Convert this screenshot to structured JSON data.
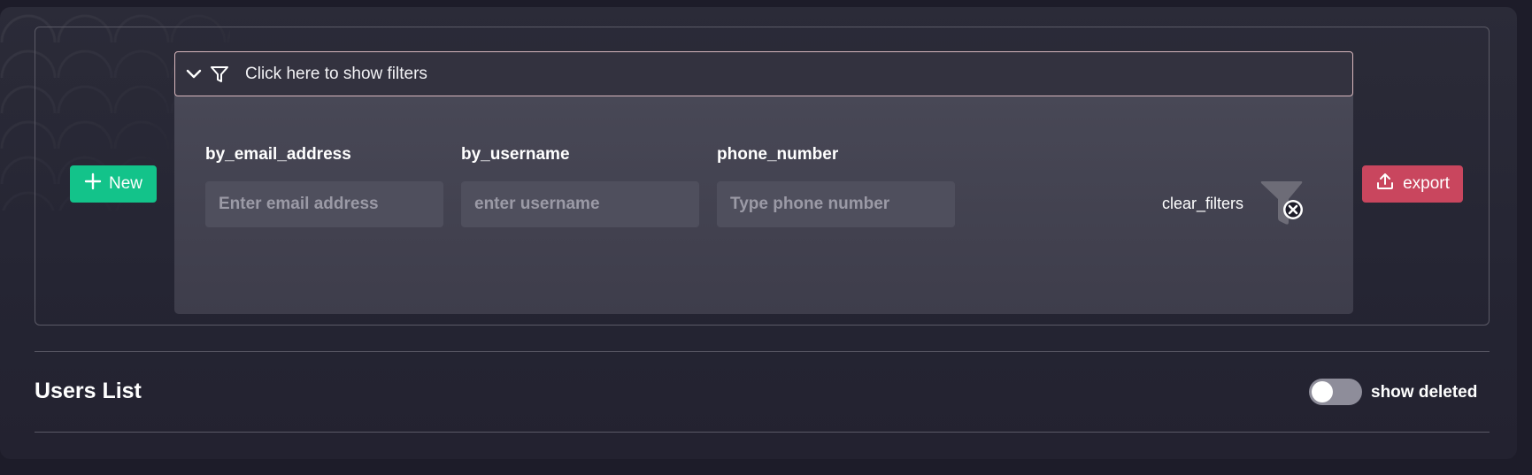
{
  "toolbar": {
    "new_label": "New",
    "export_label": "export"
  },
  "filters": {
    "header_label": "Click here to show filters",
    "email": {
      "label": "by_email_address",
      "placeholder": "Enter email address",
      "value": ""
    },
    "username": {
      "label": "by_username",
      "placeholder": "enter username",
      "value": ""
    },
    "phone": {
      "label": "phone_number",
      "placeholder": "Type phone number",
      "value": ""
    },
    "clear_label": "clear_filters"
  },
  "list": {
    "title": "Users List",
    "show_deleted_label": "show deleted",
    "show_deleted_on": false
  },
  "colors": {
    "new_button": "#13c38a",
    "export_button": "#c9465e",
    "background": "#1d1c29"
  },
  "icons": {
    "new": "plus-icon",
    "export": "upload-icon",
    "header_toggle": "chevron-down-icon",
    "header_filter": "funnel-icon",
    "clear": "clear-filter-icon"
  }
}
